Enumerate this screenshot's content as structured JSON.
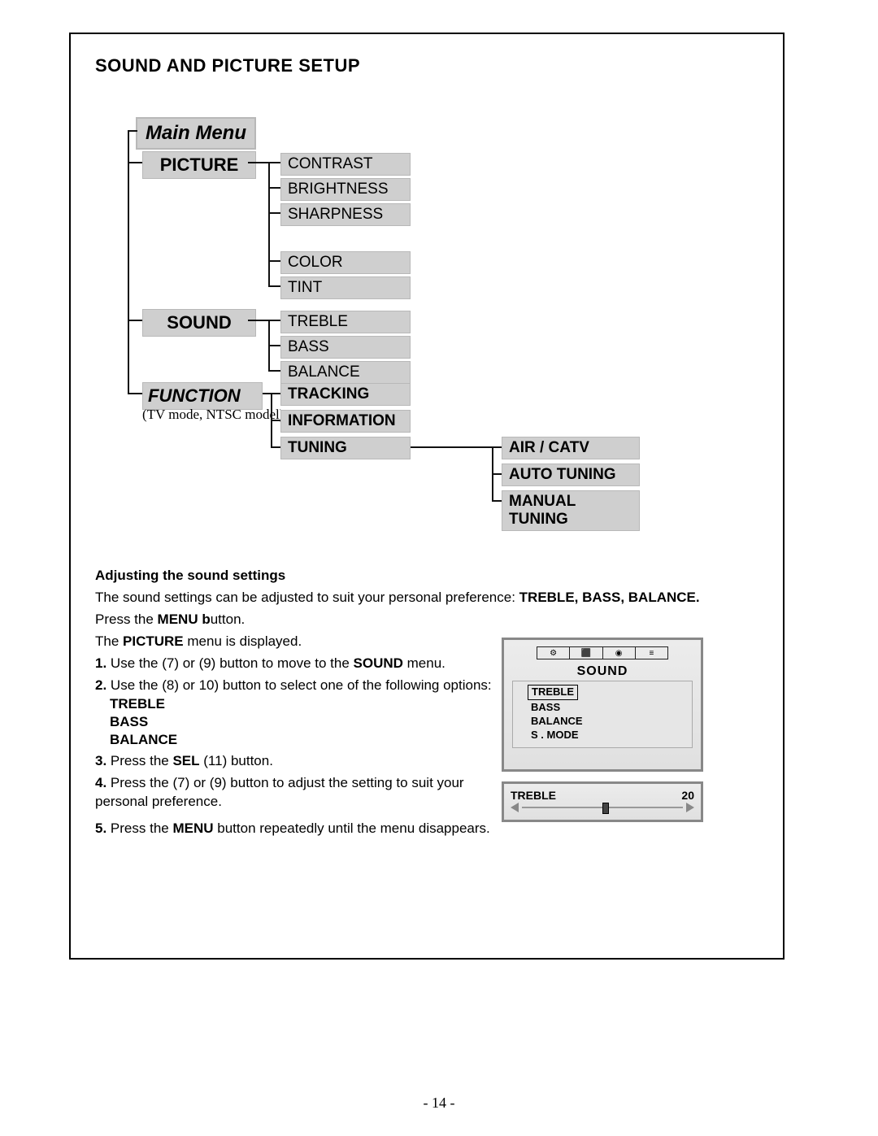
{
  "section_title": "SOUND AND PICTURE SETUP",
  "menu_tree": {
    "root": "Main Menu",
    "picture": {
      "label": "PICTURE",
      "items": [
        "CONTRAST",
        "BRIGHTNESS",
        "SHARPNESS",
        "COLOR",
        "TINT"
      ]
    },
    "sound": {
      "label": "SOUND",
      "items": [
        "TREBLE",
        "BASS",
        "BALANCE"
      ]
    },
    "function": {
      "label": "FUNCTION",
      "note": "(TV mode, NTSC model)",
      "items": [
        "TRACKING",
        "INFORMATION",
        "TUNING"
      ],
      "tuning_sub": [
        "AIR / CATV",
        "AUTO TUNING",
        "MANUAL TUNING"
      ]
    }
  },
  "instructions": {
    "sub_title": "Adjusting the sound settings",
    "intro_a": "The sound settings can be adjusted to suit your personal preference: ",
    "intro_b": "TREBLE, BASS, BALANCE.",
    "press_menu_a": "Press the ",
    "press_menu_b": "MENU b",
    "press_menu_c": "utton.",
    "pic_disp_a": "The ",
    "pic_disp_b": "PICTURE",
    "pic_disp_c": " menu is displayed.",
    "steps": {
      "s1_a": "Use the  (7) or (9) button to move to the ",
      "s1_b": "SOUND",
      "s1_c": " menu.",
      "s2": "Use the (8) or 10) button to select one of the following options:",
      "s2_opts": [
        "TREBLE",
        "BASS",
        "BALANCE"
      ],
      "s3_a": "Press the ",
      "s3_b": "SEL",
      "s3_c": " (11) button.",
      "s4": "Press the (7) or (9) button to adjust the setting to suit your personal preference.",
      "s5_a": "Press the ",
      "s5_b": "MENU",
      "s5_c": " button repeatedly until the menu disappears."
    }
  },
  "osd": {
    "title": "SOUND",
    "items": [
      "TREBLE",
      "BASS",
      "BALANCE",
      "S . MODE"
    ],
    "slider_label": "TREBLE",
    "slider_value": "20"
  },
  "page_number": "- 14 -"
}
